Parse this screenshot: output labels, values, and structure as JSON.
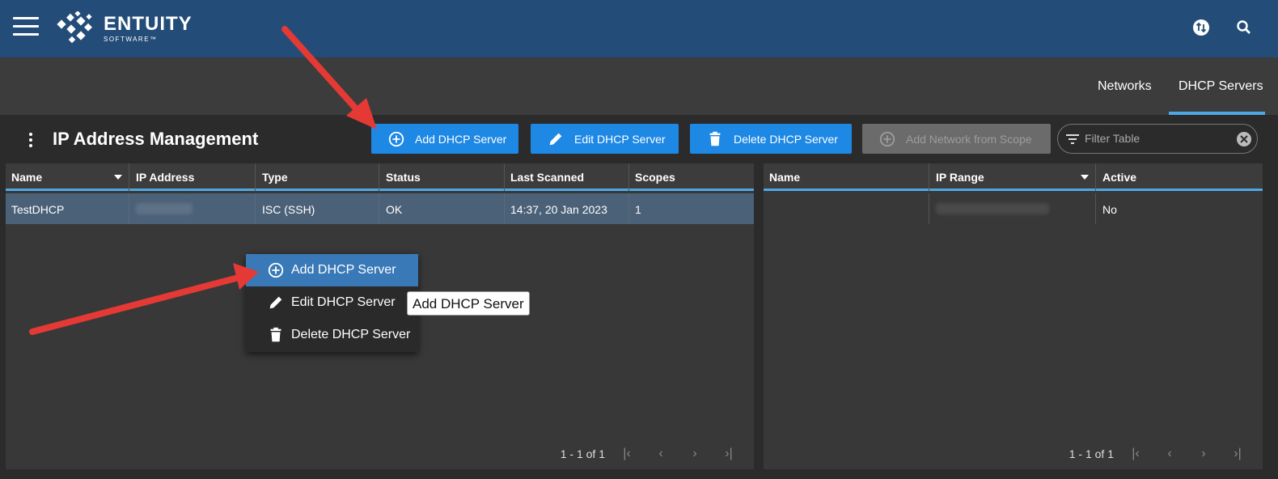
{
  "header": {
    "logo_text": "ENTUITY",
    "logo_sub": "SOFTWARE™"
  },
  "nav": {
    "tabs": [
      {
        "label": "Networks",
        "active": false
      },
      {
        "label": "DHCP Servers",
        "active": true
      }
    ]
  },
  "toolbar": {
    "title": "IP Address Management",
    "add_label": "Add DHCP Server",
    "edit_label": "Edit DHCP Server",
    "delete_label": "Delete DHCP Server",
    "add_network_label": "Add Network from Scope",
    "filter_placeholder": "Filter Table"
  },
  "left_table": {
    "columns": [
      "Name",
      "IP Address",
      "Type",
      "Status",
      "Last Scanned",
      "Scopes"
    ],
    "rows": [
      {
        "name": "TestDHCP",
        "type": "ISC (SSH)",
        "status": "OK",
        "last_scanned": "14:37, 20 Jan 2023",
        "scopes": "1"
      }
    ],
    "pager": "1 - 1 of 1"
  },
  "right_table": {
    "columns": [
      "Name",
      "IP Range",
      "Active"
    ],
    "rows": [
      {
        "name": "",
        "active": "No"
      }
    ],
    "pager": "1 - 1 of 1"
  },
  "context_menu": {
    "items": [
      "Add DHCP Server",
      "Edit DHCP Server",
      "Delete DHCP Server"
    ]
  },
  "tooltip": "Add DHCP Server",
  "colors": {
    "header_bg": "#234d78",
    "accent": "#1e88e5",
    "tab_underline": "#4fa7e3",
    "annotation_arrow": "#e53935"
  }
}
